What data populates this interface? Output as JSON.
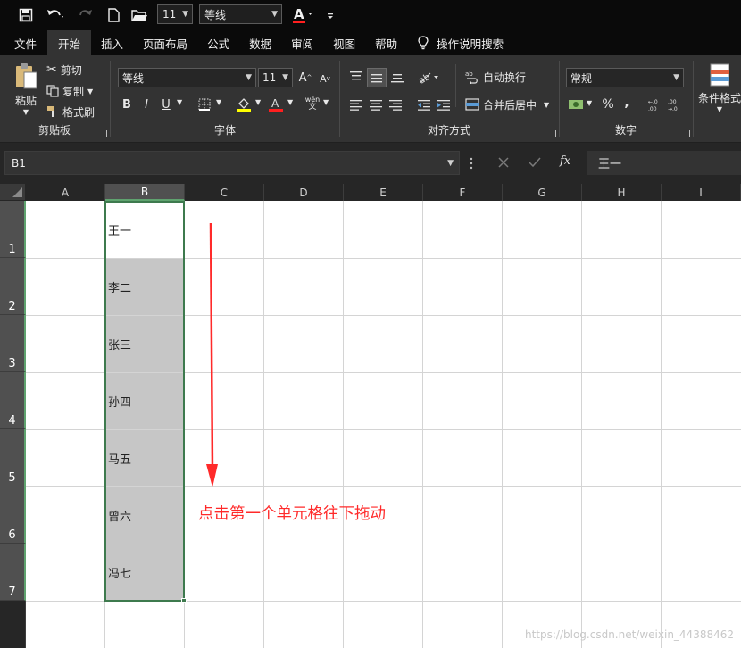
{
  "quick_access": {
    "font_size": "11",
    "font_name": "等线"
  },
  "tabs": [
    "文件",
    "开始",
    "插入",
    "页面布局",
    "公式",
    "数据",
    "审阅",
    "视图",
    "帮助",
    "操作说明搜索"
  ],
  "ribbon": {
    "clipboard": {
      "paste": "粘贴",
      "cut": "剪切",
      "copy": "复制",
      "format_painter": "格式刷",
      "label": "剪贴板"
    },
    "font": {
      "font_name": "等线",
      "font_size": "11",
      "bold": "B",
      "italic": "I",
      "underline": "U",
      "phonetic": "wén",
      "label": "字体"
    },
    "alignment": {
      "wrap_text": "自动换行",
      "merge_center": "合并后居中",
      "label": "对齐方式"
    },
    "number": {
      "format": "常规",
      "percent": "%",
      "comma": ",",
      "label": "数字"
    },
    "styles": {
      "conditional_format": "条件格式"
    }
  },
  "formula_bar": {
    "name_box": "B1",
    "fx": "fx",
    "value": "王一"
  },
  "grid": {
    "columns": [
      "A",
      "B",
      "C",
      "D",
      "E",
      "F",
      "G",
      "H",
      "I"
    ],
    "rows": [
      "1",
      "2",
      "3",
      "4",
      "5",
      "6",
      "7"
    ],
    "cells_b": [
      "王一",
      "李二",
      "张三",
      "孙四",
      "马五",
      "曾六",
      "冯七"
    ]
  },
  "annotation": "点击第一个单元格往下拖动",
  "watermark": "https://blog.csdn.net/weixin_44388462",
  "colors": {
    "annotation_red": "#ff2a2a",
    "selection_green": "#3e7a4e",
    "ribbon_bg": "#333333",
    "selected_fill": "#c6c6c6"
  }
}
